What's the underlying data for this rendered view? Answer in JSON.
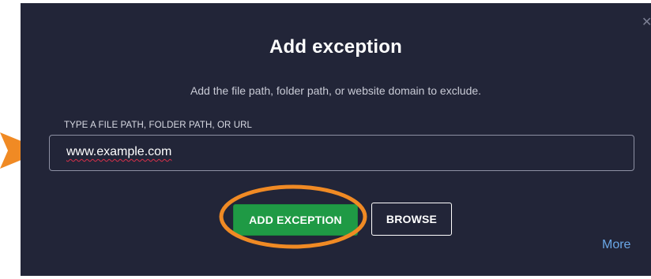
{
  "dialog": {
    "title": "Add exception",
    "subtitle": "Add the file path, folder path, or website domain to exclude.",
    "close_icon": "close-icon",
    "field_label": "TYPE A FILE PATH, FOLDER PATH, OR URL",
    "input_value": "www.example.com",
    "add_button_label": "ADD EXCEPTION",
    "browse_button_label": "BROWSE",
    "more_link_label": "More"
  },
  "annotations": {
    "highlight_ring_icon": "circle-highlight",
    "pointer_arrow_icon": "arrow-right-icon"
  },
  "colors": {
    "dialog_background": "#222538",
    "primary_button": "#1f9a45",
    "link": "#6aa7e6",
    "annotation_orange": "#f08a24",
    "spellcheck_underline": "#d9304a"
  }
}
